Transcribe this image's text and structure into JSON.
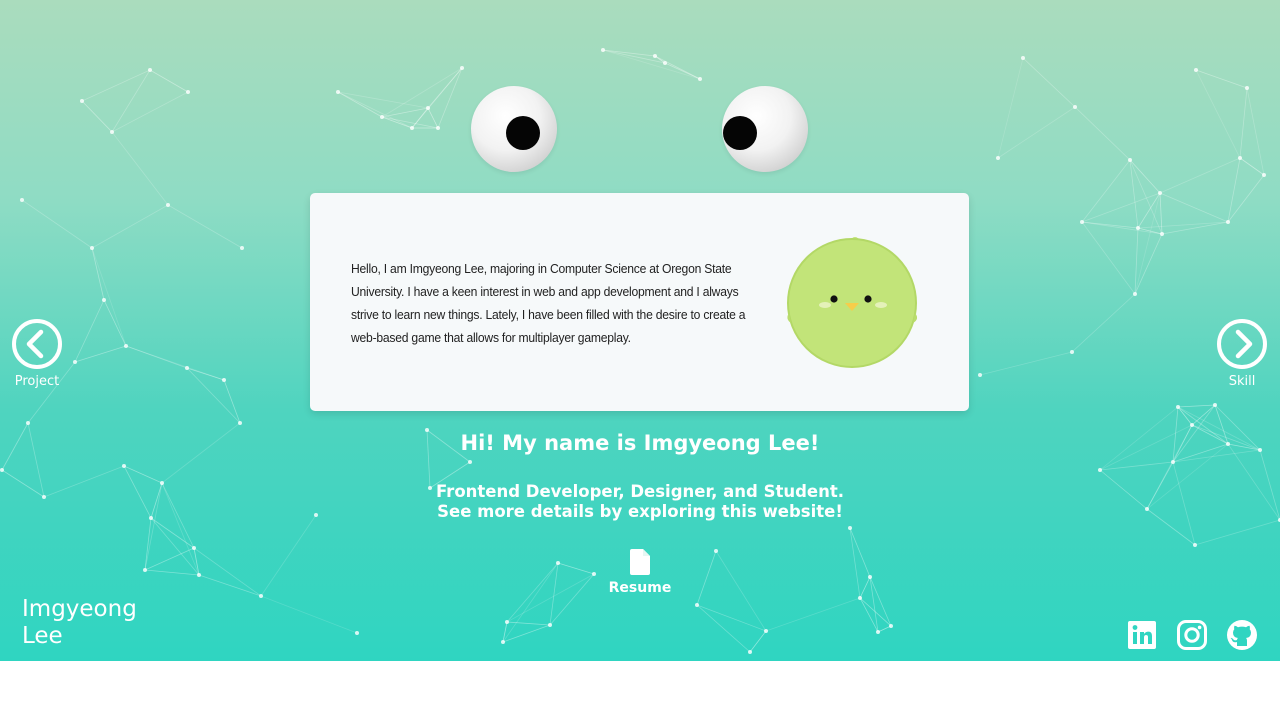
{
  "intro": {
    "text": "Hello, I am Imgyeong Lee, majoring in Computer Science at Oregon State University. I have a keen interest in web and app development and I always strive to learn new things. Lately, I have been filled with the desire to create a web-based game that allows for multiplayer gameplay."
  },
  "nav": {
    "prev_label": "Project",
    "next_label": "Skill",
    "prev_icon": "chevron-left-circle-icon",
    "next_icon": "chevron-right-circle-icon"
  },
  "hero": {
    "greeting": "Hi! My name is Imgyeong Lee!",
    "subtitle_line1": "Frontend Developer, Designer, and Student.",
    "subtitle_line2": "See more details by exploring this website!"
  },
  "resume": {
    "label": "Resume",
    "icon": "document-icon"
  },
  "brand": {
    "line1": "Imgyeong",
    "line2": "Lee"
  },
  "social": [
    {
      "name": "linkedin",
      "icon": "linkedin-icon"
    },
    {
      "name": "instagram",
      "icon": "instagram-icon"
    },
    {
      "name": "github",
      "icon": "github-icon"
    }
  ],
  "colors": {
    "gradient_top": "#aadcbd",
    "gradient_bottom": "#2fd5c1",
    "card_background": "#f6f9fa",
    "avatar_green": "#c2e479",
    "text_light": "#ffffff"
  }
}
